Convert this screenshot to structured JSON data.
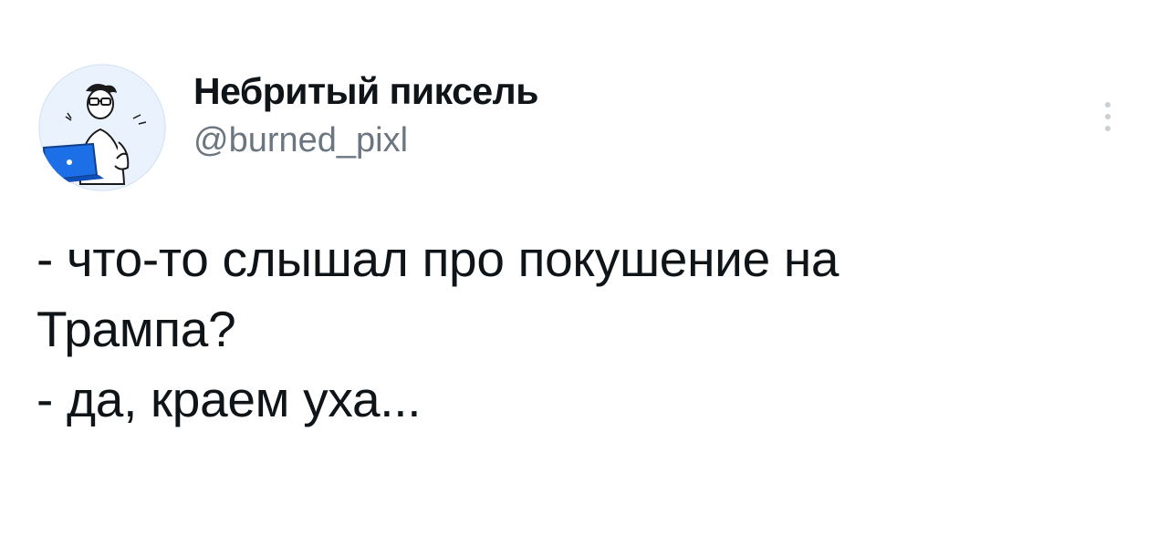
{
  "author": {
    "display_name": "Небритый пиксель",
    "handle": "@burned_pixl",
    "avatar_icon": "person-with-laptop-illustration"
  },
  "menu": {
    "icon": "more-vertical-icon"
  },
  "tweet": {
    "lines": [
      "- что-то слышал про покушение на",
      "Трампа?",
      "- да, краем уха..."
    ]
  },
  "colors": {
    "text_primary": "#0f1419",
    "text_secondary": "#6b7680",
    "avatar_accent": "#1d6fe8",
    "background": "#ffffff"
  }
}
